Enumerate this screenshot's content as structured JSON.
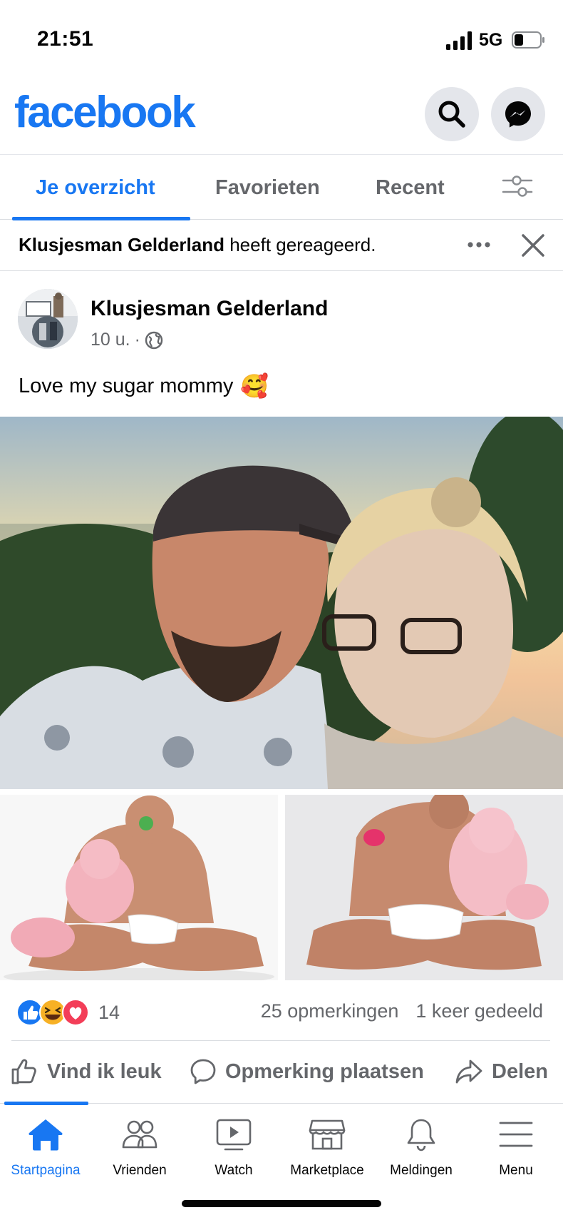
{
  "status": {
    "time": "21:51",
    "network": "5G"
  },
  "header": {
    "logo": "facebook",
    "icons": [
      "search-icon",
      "messenger-icon"
    ]
  },
  "tabs": [
    {
      "label": "Je overzicht",
      "active": true
    },
    {
      "label": "Favorieten",
      "active": false
    },
    {
      "label": "Recent",
      "active": false
    }
  ],
  "banner": {
    "name": "Klusjesman Gelderland",
    "text": "heeft gereageerd."
  },
  "post": {
    "author": "Klusjesman Gelderland",
    "time": "10 u.",
    "separator": "·",
    "text": "Love my sugar mommy",
    "emoji": "🥰"
  },
  "stats": {
    "reaction_count": "14",
    "comments": "25 opmerkingen",
    "shares": "1 keer gedeeld"
  },
  "actions": {
    "like": "Vind ik leuk",
    "comment": "Opmerking plaatsen",
    "share": "Delen"
  },
  "nav": [
    {
      "label": "Startpagina",
      "icon": "home-icon",
      "active": true
    },
    {
      "label": "Vrienden",
      "icon": "friends-icon",
      "active": false
    },
    {
      "label": "Watch",
      "icon": "watch-icon",
      "active": false
    },
    {
      "label": "Marketplace",
      "icon": "marketplace-icon",
      "active": false
    },
    {
      "label": "Meldingen",
      "icon": "bell-icon",
      "active": false
    },
    {
      "label": "Menu",
      "icon": "menu-icon",
      "active": false
    }
  ],
  "colors": {
    "brand": "#1877f2",
    "secondary_text": "#65676b",
    "like_blue": "#1877f2",
    "love_red": "#f33e58",
    "haha_yellow": "#f7b125"
  }
}
